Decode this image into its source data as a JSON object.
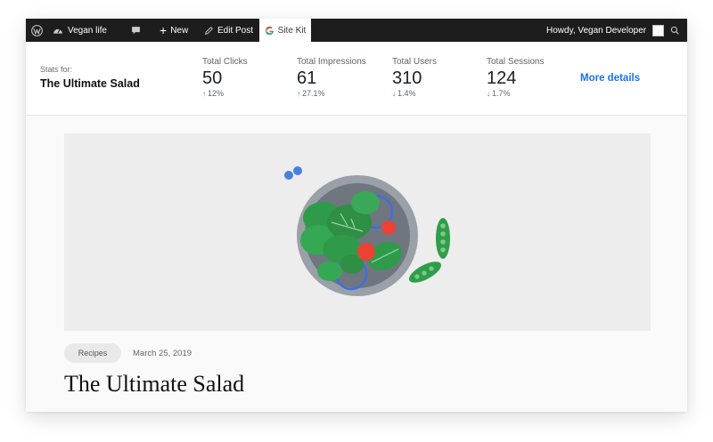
{
  "admin_bar": {
    "site_name": "Vegan life",
    "new_label": "New",
    "edit_post_label": "Edit Post",
    "site_kit_label": "Site Kit",
    "howdy": "Howdy, Vegan Developer",
    "icons": [
      "wordpress-icon",
      "dashboard-icon",
      "comment-icon",
      "plus-icon",
      "pencil-icon",
      "google-icon",
      "avatar",
      "search-icon"
    ]
  },
  "stats": {
    "stats_for_label": "Stats for:",
    "page_title": "The Ultimate Salad",
    "metrics": [
      {
        "label": "Total Clicks",
        "value": "50",
        "change": "12%",
        "direction": "up"
      },
      {
        "label": "Total Impressions",
        "value": "61",
        "change": "27.1%",
        "direction": "up"
      },
      {
        "label": "Total Users",
        "value": "310",
        "change": "1.4%",
        "direction": "down"
      },
      {
        "label": "Total Sessions",
        "value": "124",
        "change": "1.7%",
        "direction": "down"
      }
    ],
    "more_details": "More details"
  },
  "post": {
    "category": "Recipes",
    "date": "March 25, 2019",
    "title": "The Ultimate Salad"
  },
  "colors": {
    "admin_bar_bg": "#1d1d1d",
    "link_blue": "#1a73e8",
    "up_green": "#1e8e3e",
    "down_red": "#d93025",
    "salad_green": "#2e9e48",
    "tomato_red": "#ea4335"
  }
}
